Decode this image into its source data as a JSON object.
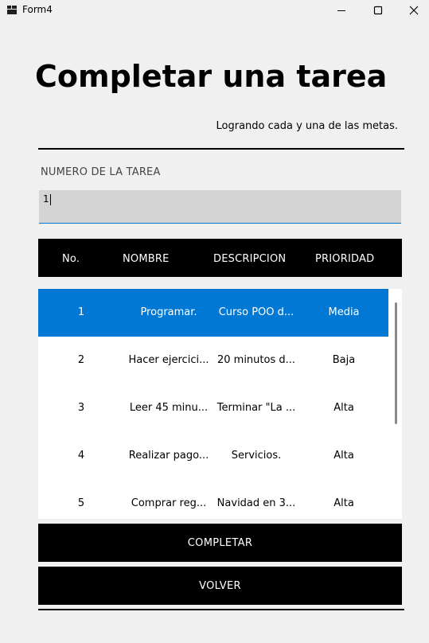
{
  "window": {
    "title": "Form4"
  },
  "header": {
    "title": "Completar una tarea",
    "subtitle": "Logrando cada y una de las metas."
  },
  "form": {
    "task_number_label": "NUMERO DE LA TAREA",
    "task_number_value": "1"
  },
  "table": {
    "columns": [
      "No.",
      "NOMBRE",
      "DESCRIPCION",
      "PRIORIDAD"
    ],
    "rows": [
      {
        "no": "1",
        "nombre": "Programar.",
        "descripcion": "Curso POO d...",
        "prioridad": "Media",
        "selected": true
      },
      {
        "no": "2",
        "nombre": "Hacer ejercici...",
        "descripcion": "20 minutos d...",
        "prioridad": "Baja",
        "selected": false
      },
      {
        "no": "3",
        "nombre": "Leer 45 minu...",
        "descripcion": "Terminar \"La ...",
        "prioridad": "Alta",
        "selected": false
      },
      {
        "no": "4",
        "nombre": "Realizar pago...",
        "descripcion": "Servicios.",
        "prioridad": "Alta",
        "selected": false
      },
      {
        "no": "5",
        "nombre": "Comprar reg...",
        "descripcion": "Navidad en 3...",
        "prioridad": "Alta",
        "selected": false
      }
    ]
  },
  "buttons": {
    "complete_label": "COMPLETAR",
    "back_label": "VOLVER"
  },
  "icons": {
    "app": "app-window-icon",
    "minimize": "minimize-icon",
    "maximize": "maximize-icon",
    "close": "close-icon"
  },
  "colors": {
    "selection": "#0078d4",
    "header_bg": "#000000",
    "input_bg": "#d4d4d4"
  }
}
